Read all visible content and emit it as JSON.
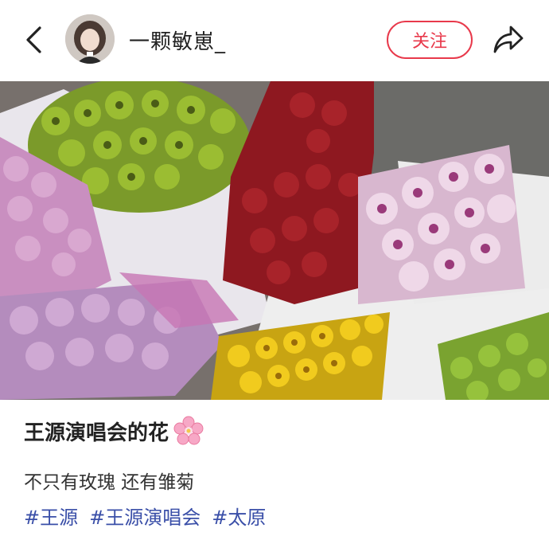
{
  "header": {
    "username": "一颗敏崽_",
    "follow_label": "关注"
  },
  "post": {
    "title": "王源演唱会的花",
    "description": "不只有玫瑰 还有雏菊",
    "tags": [
      "#王源",
      "#王源演唱会",
      "#太原"
    ]
  },
  "colors": {
    "accent": "#e8394b",
    "tag": "#3a4fa8"
  }
}
